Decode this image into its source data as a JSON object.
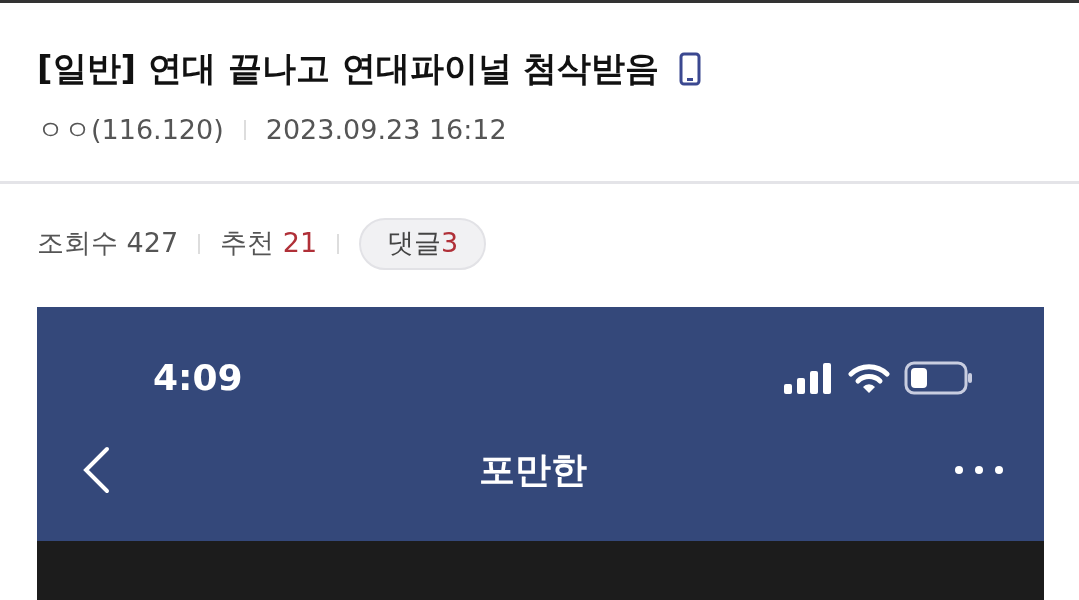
{
  "post": {
    "title": "[일반] 연대 끝나고 연대파이널 첨삭받음",
    "author": "ㅇㅇ(116.120)",
    "date": "2023.09.23 16:12"
  },
  "stats": {
    "views_label": "조회수",
    "views": "427",
    "recommend_label": "추천",
    "recommend": "21",
    "comments_label": "댓글",
    "comments": "3"
  },
  "embedded_screenshot": {
    "time": "4:09",
    "nav_title": "포만한"
  }
}
